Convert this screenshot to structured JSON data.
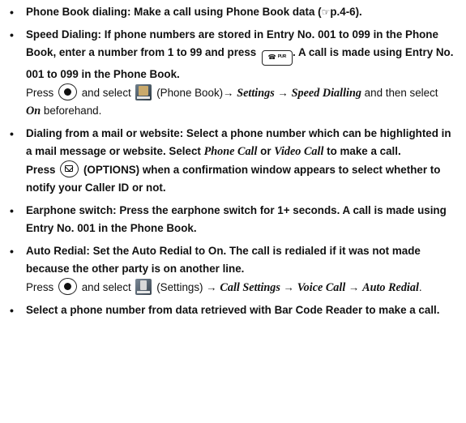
{
  "items": [
    {
      "heading": "Phone Book dialing: Make a call using Phone Book data (",
      "ref_icon": "☞",
      "ref_text": "p.4-6)."
    },
    {
      "heading": "Speed Dialing: If phone numbers are stored in Entry No. 001 to 099 in the Phone Book, enter a number from 1 to 99 and press",
      "button_text": "☎ ᴾᵁᴿ",
      "heading_end": ". A call is made using Entry No. 001 to 099 in the Phone Book.",
      "press": "Press",
      "and_select": "and select",
      "app_name": "(Phone Book)",
      "arrow1": "→",
      "settings": "Settings",
      "arrow2": "→",
      "speed_dialling": "Speed Dialling",
      "and_then": "and then select",
      "on": "On",
      "beforehand": "beforehand."
    },
    {
      "heading_a": "Dialing from a mail or website: Select a phone number which can be highlighted in a mail message or website. Select",
      "phone_call": "Phone Call",
      "or": "or",
      "video_call": "Video Call",
      "heading_b": "to make a call.",
      "press": "Press",
      "options": "(OPTIONS) when a confirmation window appears to select whether to notify your Caller ID or not."
    },
    {
      "heading": "Earphone switch: Press the earphone switch for 1+ seconds. A call is made using Entry No. 001 in the Phone Book."
    },
    {
      "heading": "Auto Redial: Set the Auto Redial to On. The call is redialed if it was not made because the other party is on another line.",
      "press": "Press",
      "and_select": "and select",
      "app_name": "(Settings)",
      "arrow1": "→",
      "call_settings": "Call Settings",
      "arrow2": "→",
      "voice_call": "Voice Call",
      "arrow3": "→",
      "auto_redial": "Auto Redial",
      "period": "."
    },
    {
      "heading": "Select a phone number from data retrieved with Bar Code Reader to make a call."
    }
  ],
  "bullet": "•",
  "icons": [
    "center-key-icon",
    "phone-book-app-icon",
    "mail-key-icon",
    "settings-app-icon",
    "call-key-icon",
    "reference-icon"
  ]
}
